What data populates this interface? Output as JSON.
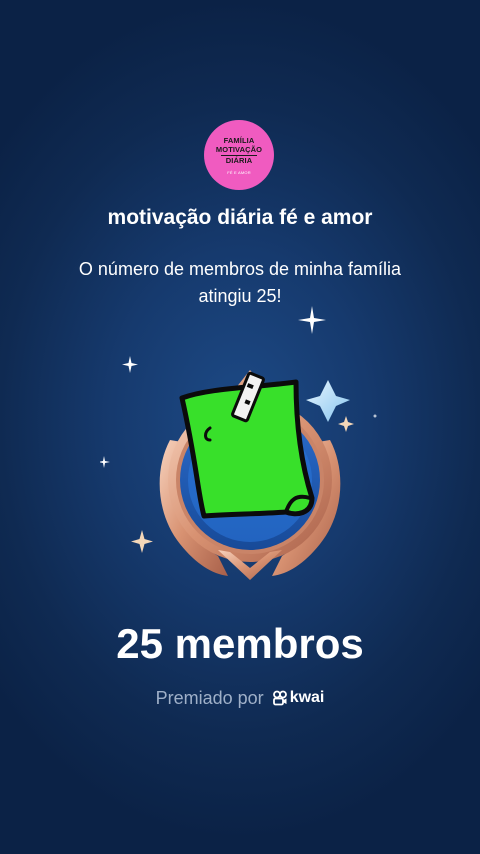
{
  "avatar": {
    "line1": "FAMÍLIA",
    "line2": "MOTIVAÇÃO",
    "line3": "DIÁRIA",
    "sub": "FÉ E AMOR"
  },
  "family_name": "motivação diária fé e amor",
  "message": "O número de membros de minha família atingiu 25!",
  "members_count": "25 membros",
  "awarded_by": {
    "label": "Premiado por",
    "brand": "kwai"
  },
  "icons": [
    "sparkle-icon",
    "badge-icon",
    "kwai-logo-icon"
  ],
  "colors": {
    "background": "#0f2a52",
    "avatar": "#f05bc0",
    "note_green": "#38e02a",
    "badge_rose_gold": "#e3a98a",
    "muted_text": "#9fb0c8"
  }
}
